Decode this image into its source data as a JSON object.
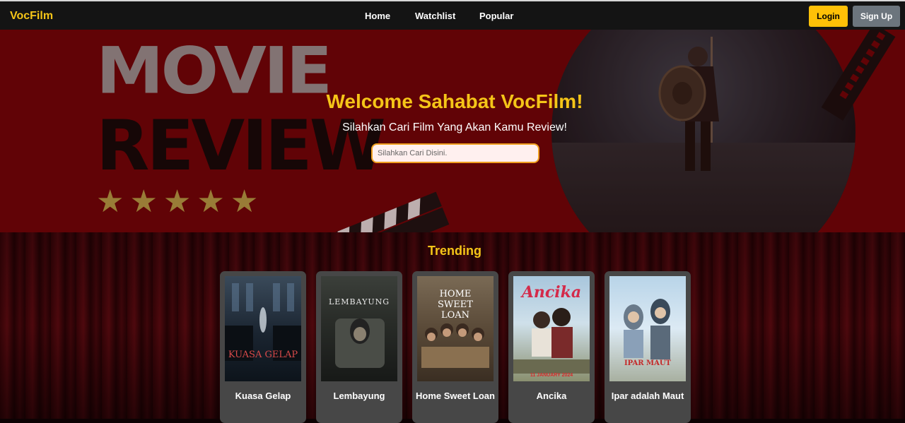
{
  "nav": {
    "brand": "VocFilm",
    "links": [
      "Home",
      "Watchlist",
      "Popular"
    ],
    "login": "Login",
    "signup": "Sign Up"
  },
  "hero": {
    "bg_words": [
      "MOVIE",
      "REVIEW"
    ],
    "title": "Welcome Sahabat VocFilm!",
    "subtitle": "Silahkan Cari Film Yang Akan Kamu Review!",
    "search_placeholder": "Silahkan Cari Disini."
  },
  "trending": {
    "title": "Trending",
    "movies": [
      {
        "title": "Kuasa Gelap",
        "poster_text": "KUASA GELAP"
      },
      {
        "title": "Lembayung",
        "poster_text": "LEMBAYUNG"
      },
      {
        "title": "Home Sweet Loan",
        "poster_text": "HOME SWEET LOAN"
      },
      {
        "title": "Ancika",
        "poster_text": "Ancika",
        "poster_date": "11 JANUARY 2024"
      },
      {
        "title": "Ipar adalah Maut",
        "poster_text": "IPAR MAUT"
      }
    ]
  },
  "colors": {
    "accent": "#f5c518",
    "hero_bg": "#6e0408",
    "card_bg": "#474747",
    "signup_bg": "#6c757d"
  }
}
